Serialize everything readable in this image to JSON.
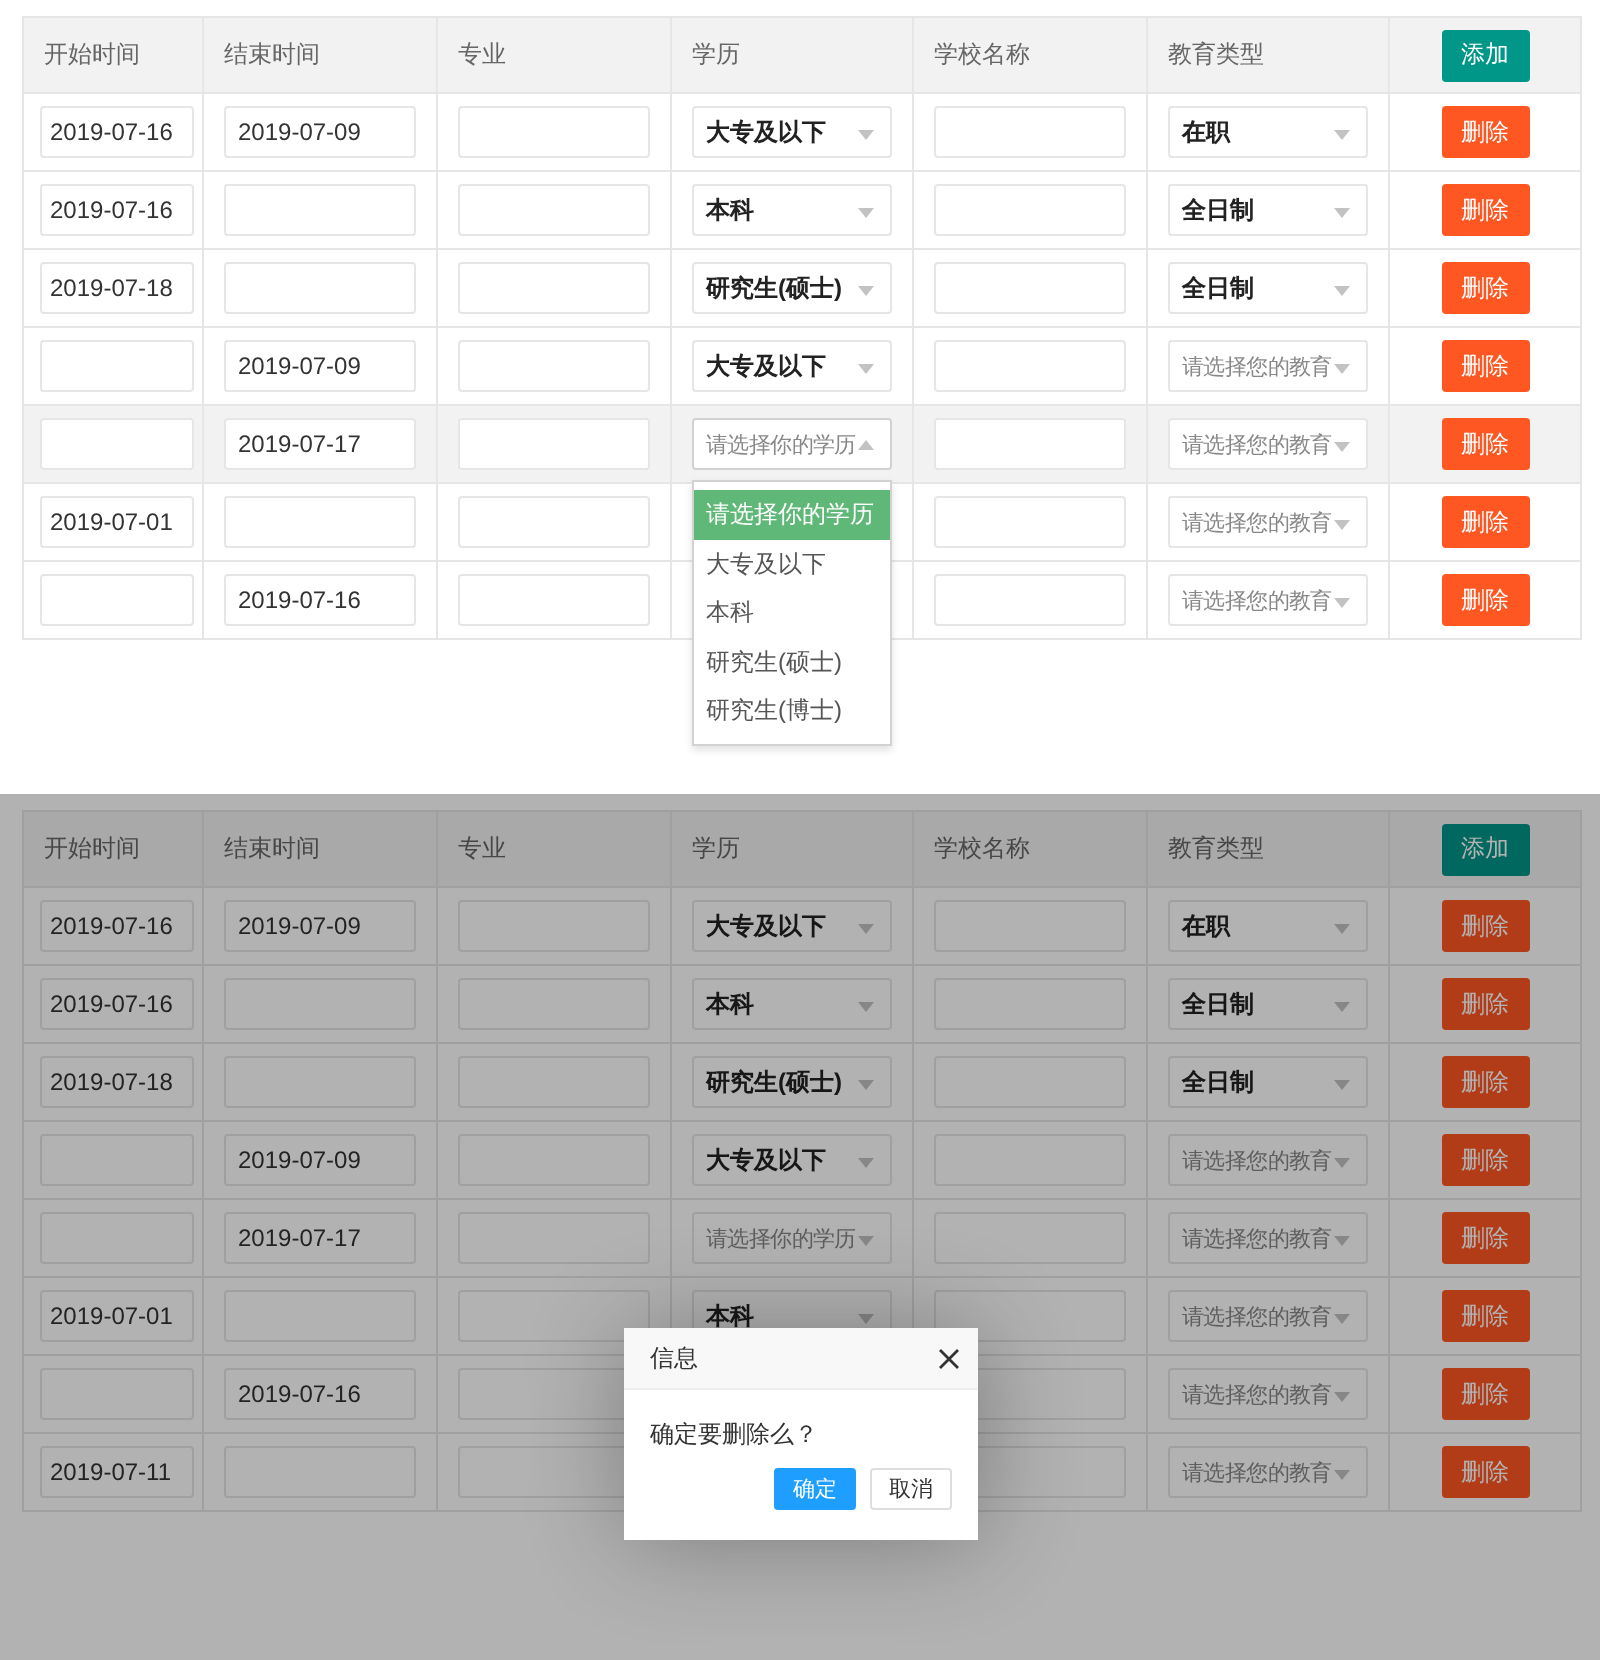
{
  "views": [
    {
      "table": {
        "columns": [
          "开始时间",
          "结束时间",
          "专业",
          "学历",
          "学校名称",
          "教育类型"
        ],
        "add_button": "添加",
        "rows": [
          {
            "start": "2019-07-16",
            "end": "2019-07-09",
            "education": {
              "value": "大专及以下",
              "expanded": false
            },
            "education_type": {
              "value": "在职"
            },
            "delete_button": "删除",
            "hovered": false
          },
          {
            "start": "2019-07-16",
            "education": {
              "value": "本科",
              "expanded": false
            },
            "education_type": {
              "value": "全日制"
            },
            "delete_button": "删除",
            "hovered": false
          },
          {
            "start": "2019-07-18",
            "education": {
              "value": "研究生(硕士)",
              "expanded": false
            },
            "education_type": {
              "value": "全日制"
            },
            "delete_button": "删除",
            "hovered": false
          },
          {
            "end": "2019-07-09",
            "education": {
              "value": "大专及以下",
              "expanded": false
            },
            "education_type": {
              "placeholder": "请选择您的教育"
            },
            "delete_button": "删除",
            "hovered": false
          },
          {
            "end": "2019-07-17",
            "education": {
              "placeholder": "请选择你的学历",
              "expanded": true,
              "options": [
                {
                  "label": "请选择你的学历",
                  "selected": true
                },
                {
                  "label": "大专及以下",
                  "selected": false
                },
                {
                  "label": "本科",
                  "selected": false
                },
                {
                  "label": "研究生(硕士)",
                  "selected": false
                },
                {
                  "label": "研究生(博士)",
                  "selected": false
                }
              ]
            },
            "education_type": {
              "placeholder": "请选择您的教育"
            },
            "delete_button": "删除",
            "hovered": true
          },
          {
            "start": "2019-07-01",
            "education_type": {
              "placeholder": "请选择您的教育"
            },
            "delete_button": "删除",
            "hovered": false
          },
          {
            "end": "2019-07-16",
            "education_type": {
              "placeholder": "请选择您的教育"
            },
            "delete_button": "删除",
            "hovered": false
          }
        ]
      }
    },
    {
      "table": {
        "columns": [
          "开始时间",
          "结束时间",
          "专业",
          "学历",
          "学校名称",
          "教育类型"
        ],
        "add_button": "添加",
        "rows": [
          {
            "start": "2019-07-16",
            "end": "2019-07-09",
            "education": {
              "value": "大专及以下",
              "expanded": false
            },
            "education_type": {
              "value": "在职"
            },
            "delete_button": "删除"
          },
          {
            "start": "2019-07-16",
            "education": {
              "value": "本科",
              "expanded": false
            },
            "education_type": {
              "value": "全日制"
            },
            "delete_button": "删除"
          },
          {
            "start": "2019-07-18",
            "education": {
              "value": "研究生(硕士)",
              "expanded": false
            },
            "education_type": {
              "value": "全日制"
            },
            "delete_button": "删除"
          },
          {
            "end": "2019-07-09",
            "education": {
              "value": "大专及以下",
              "expanded": false
            },
            "education_type": {
              "placeholder": "请选择您的教育"
            },
            "delete_button": "删除"
          },
          {
            "end": "2019-07-17",
            "education": {
              "placeholder": "请选择你的学历",
              "expanded": false
            },
            "education_type": {
              "placeholder": "请选择您的教育"
            },
            "delete_button": "删除"
          },
          {
            "start": "2019-07-01",
            "education": {
              "value": "本科",
              "expanded": false
            },
            "education_type": {
              "placeholder": "请选择您的教育"
            },
            "delete_button": "删除"
          },
          {
            "end": "2019-07-16",
            "education_type": {
              "placeholder": "请选择您的教育"
            },
            "delete_button": "删除"
          },
          {
            "start": "2019-07-11",
            "education_type": {
              "placeholder": "请选择您的教育"
            },
            "delete_button": "删除"
          }
        ]
      },
      "dialog": {
        "title": "信息",
        "message": "确定要删除么？",
        "buttons": [
          "确定",
          "取消"
        ]
      }
    }
  ]
}
